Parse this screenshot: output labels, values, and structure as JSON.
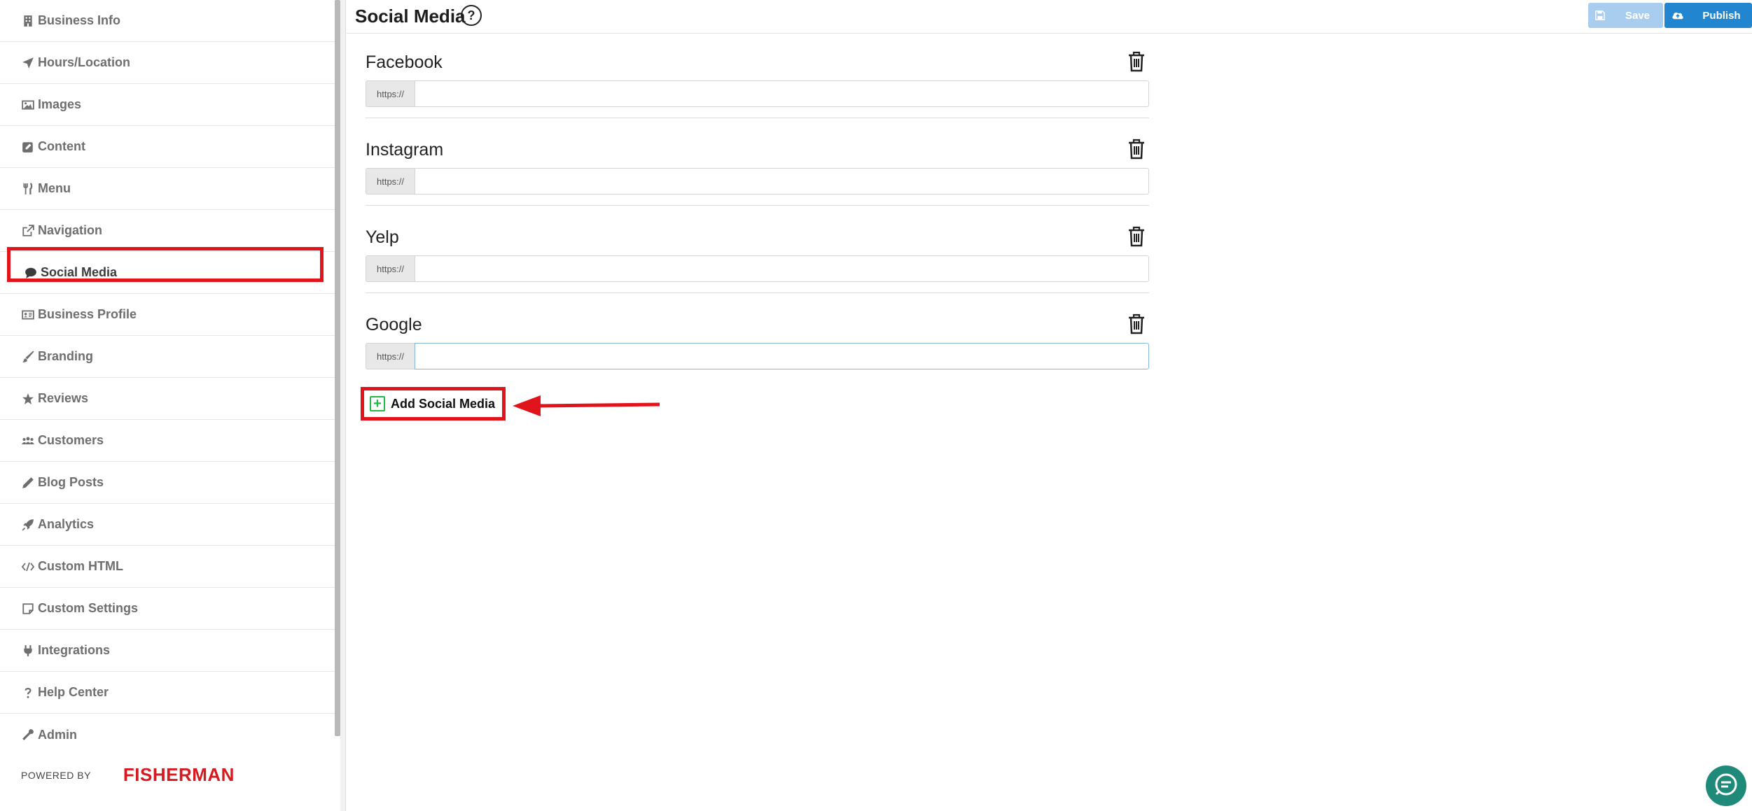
{
  "header": {
    "title": "Social Media",
    "help": "?",
    "save_label": "Save",
    "publish_label": "Publish"
  },
  "sidebar": {
    "items": [
      {
        "label": "Business Info",
        "icon": "building-icon"
      },
      {
        "label": "Hours/Location",
        "icon": "location-arrow-icon"
      },
      {
        "label": "Images",
        "icon": "image-icon"
      },
      {
        "label": "Content",
        "icon": "edit-icon"
      },
      {
        "label": "Menu",
        "icon": "utensils-icon"
      },
      {
        "label": "Navigation",
        "icon": "external-link-icon"
      },
      {
        "label": "Social Media",
        "icon": "comment-icon",
        "active": true
      },
      {
        "label": "Business Profile",
        "icon": "id-card-icon"
      },
      {
        "label": "Branding",
        "icon": "paint-brush-icon"
      },
      {
        "label": "Reviews",
        "icon": "star-icon"
      },
      {
        "label": "Customers",
        "icon": "users-icon"
      },
      {
        "label": "Blog Posts",
        "icon": "pencil-icon"
      },
      {
        "label": "Analytics",
        "icon": "rocket-icon"
      },
      {
        "label": "Custom HTML",
        "icon": "code-icon"
      },
      {
        "label": "Custom Settings",
        "icon": "sticky-note-icon"
      },
      {
        "label": "Integrations",
        "icon": "plug-icon"
      },
      {
        "label": "Help Center",
        "icon": "question-icon"
      },
      {
        "label": "Admin",
        "icon": "wrench-icon"
      }
    ],
    "powered_by": "POWERED BY",
    "brand": "FISHERMAN"
  },
  "social": {
    "entries": [
      {
        "name": "Facebook",
        "prefix": "https://",
        "value": ""
      },
      {
        "name": "Instagram",
        "prefix": "https://",
        "value": ""
      },
      {
        "name": "Yelp",
        "prefix": "https://",
        "value": ""
      },
      {
        "name": "Google",
        "prefix": "https://",
        "value": ""
      }
    ],
    "add_label": "Add Social Media"
  },
  "colors": {
    "annotation": "#e2141b",
    "primary": "#2185d0",
    "primary_disabled": "#a9cdef",
    "add_icon": "#21ba45",
    "brand": "#d71920",
    "chat": "#1f8a7a"
  }
}
